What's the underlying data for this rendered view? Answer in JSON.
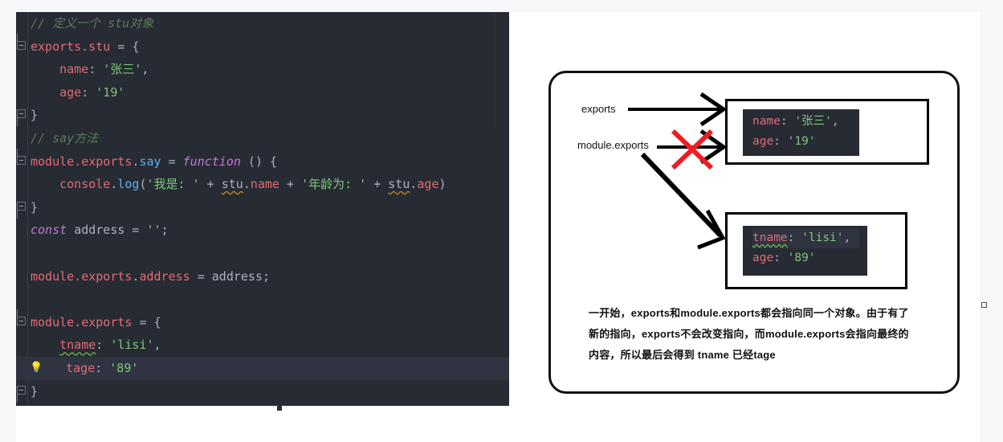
{
  "editor": {
    "lines": [
      {
        "id": "l1",
        "fold": "none",
        "tokens": [
          {
            "t": "// 定义一个 stu对象",
            "c": "com"
          }
        ]
      },
      {
        "id": "l2",
        "fold": "open",
        "tokens": [
          {
            "t": "exports",
            "c": "id"
          },
          {
            "t": ".",
            "c": "id"
          },
          {
            "t": "stu",
            "c": "id"
          },
          {
            "t": " ",
            "c": "pun"
          },
          {
            "t": "=",
            "c": "pun"
          },
          {
            "t": " ",
            "c": "pun"
          },
          {
            "t": "{",
            "c": "pun"
          }
        ]
      },
      {
        "id": "l3",
        "fold": "none",
        "tokens": [
          {
            "t": "    ",
            "c": "pun"
          },
          {
            "t": "name",
            "c": "id"
          },
          {
            "t": ": ",
            "c": "pun"
          },
          {
            "t": "'张三'",
            "c": "str"
          },
          {
            "t": ",",
            "c": "pun"
          }
        ]
      },
      {
        "id": "l4",
        "fold": "none",
        "tokens": [
          {
            "t": "    ",
            "c": "pun"
          },
          {
            "t": "age",
            "c": "id"
          },
          {
            "t": ": ",
            "c": "pun"
          },
          {
            "t": "'19'",
            "c": "str"
          }
        ]
      },
      {
        "id": "l5",
        "fold": "close",
        "tokens": [
          {
            "t": "}",
            "c": "pun"
          }
        ]
      },
      {
        "id": "l6",
        "fold": "none",
        "tokens": [
          {
            "t": "// say方法",
            "c": "com"
          }
        ]
      },
      {
        "id": "l7",
        "fold": "open",
        "tokens": [
          {
            "t": "module",
            "c": "id"
          },
          {
            "t": ".",
            "c": "id"
          },
          {
            "t": "exports",
            "c": "id"
          },
          {
            "t": ".",
            "c": "pun"
          },
          {
            "t": "say",
            "c": "prop"
          },
          {
            "t": " = ",
            "c": "pun"
          },
          {
            "t": "function",
            "c": "fn"
          },
          {
            "t": " () {",
            "c": "pun"
          }
        ]
      },
      {
        "id": "l8",
        "fold": "none",
        "tokens": [
          {
            "t": "    ",
            "c": "pun"
          },
          {
            "t": "console",
            "c": "id"
          },
          {
            "t": ".",
            "c": "pun"
          },
          {
            "t": "log",
            "c": "prop"
          },
          {
            "t": "(",
            "c": "pun"
          },
          {
            "t": "'我是: '",
            "c": "str"
          },
          {
            "t": " + ",
            "c": "pun"
          },
          {
            "t": "stu",
            "c": "warn"
          },
          {
            "t": ".",
            "c": "pun"
          },
          {
            "t": "name",
            "c": "id"
          },
          {
            "t": " + ",
            "c": "pun"
          },
          {
            "t": "'年龄为: '",
            "c": "str"
          },
          {
            "t": " + ",
            "c": "pun"
          },
          {
            "t": "stu",
            "c": "warn"
          },
          {
            "t": ".",
            "c": "pun"
          },
          {
            "t": "age",
            "c": "id"
          },
          {
            "t": ")",
            "c": "pun"
          }
        ]
      },
      {
        "id": "l9",
        "fold": "close",
        "tokens": [
          {
            "t": "}",
            "c": "pun"
          }
        ]
      },
      {
        "id": "l10",
        "fold": "none",
        "tokens": [
          {
            "t": "const",
            "c": "kw"
          },
          {
            "t": " ",
            "c": "pun"
          },
          {
            "t": "address",
            "c": "var"
          },
          {
            "t": " = ",
            "c": "pun"
          },
          {
            "t": "''",
            "c": "str"
          },
          {
            "t": ";",
            "c": "pun"
          }
        ]
      },
      {
        "id": "l11",
        "fold": "none",
        "tokens": [
          {
            "t": "",
            "c": "pun"
          }
        ]
      },
      {
        "id": "l12",
        "fold": "none",
        "tokens": [
          {
            "t": "module",
            "c": "id"
          },
          {
            "t": ".",
            "c": "id"
          },
          {
            "t": "exports",
            "c": "id"
          },
          {
            "t": ".",
            "c": "pun"
          },
          {
            "t": "address",
            "c": "id"
          },
          {
            "t": " = ",
            "c": "pun"
          },
          {
            "t": "address",
            "c": "var"
          },
          {
            "t": ";",
            "c": "pun"
          }
        ]
      },
      {
        "id": "l13",
        "fold": "none",
        "tokens": [
          {
            "t": "",
            "c": "pun"
          }
        ]
      },
      {
        "id": "l14",
        "fold": "open",
        "tokens": [
          {
            "t": "module",
            "c": "id"
          },
          {
            "t": ".",
            "c": "id"
          },
          {
            "t": "exports",
            "c": "id"
          },
          {
            "t": " = ",
            "c": "pun"
          },
          {
            "t": "{",
            "c": "pun"
          }
        ]
      },
      {
        "id": "l15",
        "fold": "none",
        "tokens": [
          {
            "t": "    ",
            "c": "pun"
          },
          {
            "t": "tname",
            "c": "warn2"
          },
          {
            "t": ": ",
            "c": "pun"
          },
          {
            "t": "'lisi'",
            "c": "str"
          },
          {
            "t": ",",
            "c": "pun"
          }
        ]
      },
      {
        "id": "l16",
        "fold": "none",
        "current": true,
        "bulb": "lightbulb-icon",
        "tokens": [
          {
            "t": "   ",
            "c": "pun"
          },
          {
            "t": "t",
            "c": "cur"
          },
          {
            "t": "age",
            "c": "id"
          },
          {
            "t": ": ",
            "c": "pun"
          },
          {
            "t": "'89'",
            "c": "str"
          }
        ]
      },
      {
        "id": "l17",
        "fold": "close",
        "tokens": [
          {
            "t": "}",
            "c": "pun"
          }
        ]
      }
    ],
    "theme": {
      "background": "#272b33",
      "current_line": "#2f3440",
      "comment": "#5c7a5c",
      "identifier": "#e06c75",
      "property": "#61afef",
      "string": "#7ec77e",
      "keyword": "#c678dd",
      "punctuation": "#a9b1c2",
      "variable": "#abb2bf"
    }
  },
  "diagram": {
    "labels": {
      "exports": "exports",
      "module_exports": "module.exports"
    },
    "cross_marker": {
      "name": "red-x-marker",
      "color": "#ee1c25"
    },
    "object_box_1": {
      "lines": [
        [
          {
            "t": "name",
            "c": "id"
          },
          {
            "t": ": ",
            "c": "pun"
          },
          {
            "t": "'张三'",
            "c": "str"
          },
          {
            "t": ",",
            "c": "pun"
          }
        ],
        [
          {
            "t": "age",
            "c": "id"
          },
          {
            "t": ": ",
            "c": "pun"
          },
          {
            "t": "'19'",
            "c": "str"
          }
        ]
      ]
    },
    "object_box_2": {
      "lines": [
        [
          {
            "t": "tname",
            "c": "warn2"
          },
          {
            "t": ": ",
            "c": "pun"
          },
          {
            "t": "'lisi'",
            "c": "str"
          },
          {
            "t": ",",
            "c": "pun"
          }
        ],
        [
          {
            "t": "age",
            "c": "id"
          },
          {
            "t": ": ",
            "c": "pun"
          },
          {
            "t": "'89'",
            "c": "str"
          }
        ]
      ]
    },
    "caption": "一开始，exports和module.exports都会指向同一个对象。由于有了新的指向，exports不会改变指向，而module.exports会指向最终的内容，所以最后会得到 tname 已经tage"
  }
}
